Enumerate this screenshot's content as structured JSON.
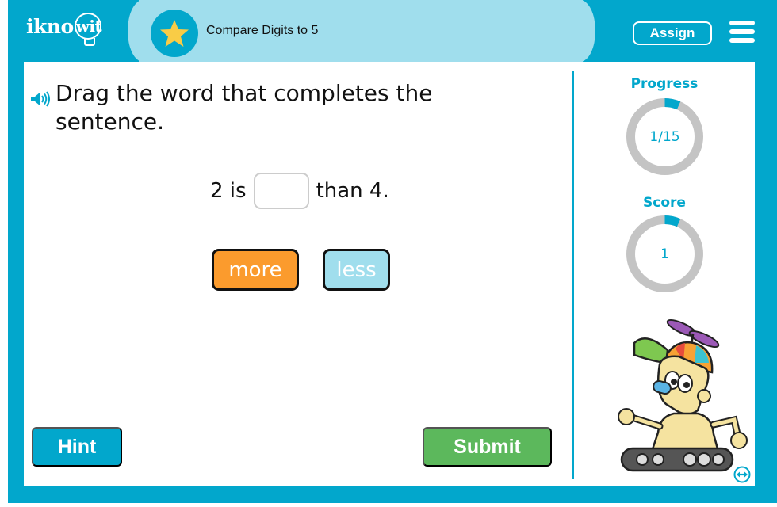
{
  "header": {
    "logo": "iknowit",
    "logo_prefix": "ikno",
    "logo_bulb": "wit",
    "lesson_title": "Compare Digits to 5",
    "assign_label": "Assign",
    "star_icon": "star-icon",
    "menu_icon": "hamburger-menu-icon"
  },
  "question": {
    "prompt": "Drag the word that completes the sentence.",
    "audio_icon": "speaker-icon",
    "sentence_before": "2 is",
    "sentence_after": "than 4.",
    "blank_value": ""
  },
  "choices": [
    {
      "label": "more",
      "color": "#fb9b2d"
    },
    {
      "label": "less",
      "color": "#a0deed"
    }
  ],
  "actions": {
    "hint_label": "Hint",
    "submit_label": "Submit"
  },
  "sidebar": {
    "progress": {
      "label": "Progress",
      "value_text": "1/15",
      "current": 1,
      "total": 15
    },
    "score": {
      "label": "Score",
      "value_text": "1",
      "fraction": 0.067
    },
    "mascot": "robot-mascot",
    "toggle_icon": "swap-arrows-icon"
  },
  "colors": {
    "primary": "#02a7cc",
    "header_band": "#a0deed",
    "star": "#f9cc46",
    "submit": "#5cb85c",
    "ring_track": "#c4c4c4"
  }
}
